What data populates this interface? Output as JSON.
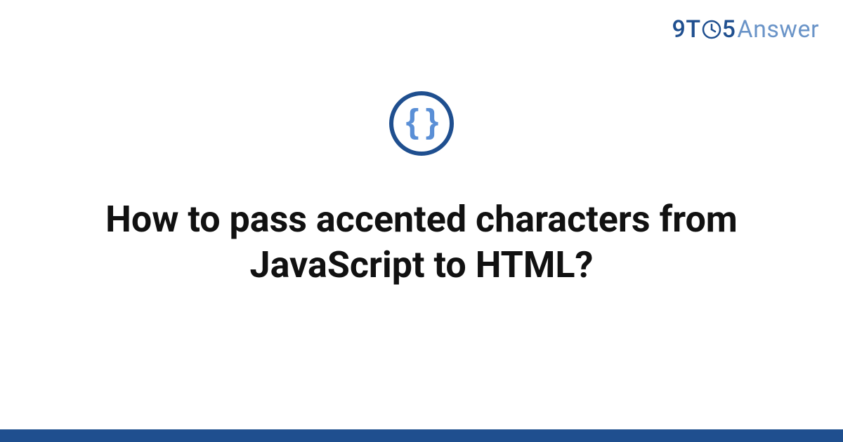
{
  "brand": {
    "part1": "9T",
    "part2": "5",
    "part3": "Answer"
  },
  "topic": {
    "icon_name": "braces-icon",
    "glyph": "{ }"
  },
  "question": {
    "title": "How to pass accented characters from JavaScript to HTML?"
  },
  "colors": {
    "brand_primary": "#1f4f8f",
    "brand_secondary": "#6a94c8",
    "icon_inner": "#5a8fd6",
    "text": "#111111",
    "background": "#ffffff"
  }
}
